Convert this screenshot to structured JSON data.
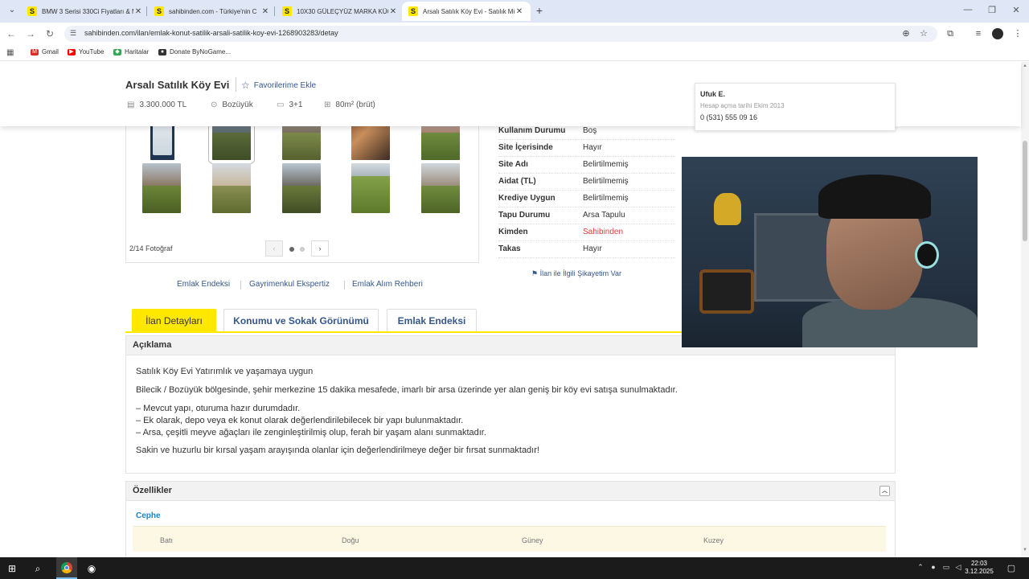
{
  "browser": {
    "tabs": [
      {
        "title": "BMW 3 Serisi 330Ci Fiyatları & M",
        "favicon": "S"
      },
      {
        "title": "sahibinden.com - Türkiye'nin C",
        "favicon": "S"
      },
      {
        "title": "10X30 GÜLEÇYÜZ MARKA KÜÇ",
        "favicon": "S"
      },
      {
        "title": "Arsalı Satılık Köy Evi - Satılık Mü",
        "favicon": "S"
      }
    ],
    "url": "sahibinden.com/ilan/emlak-konut-satilik-arsali-satilik-koy-evi-1268903283/detay",
    "bookmarks": [
      {
        "label": "Gmail",
        "color": "#d93025",
        "icon": "M"
      },
      {
        "label": "YouTube",
        "color": "#ff0000",
        "icon": "▶"
      },
      {
        "label": "Haritalar",
        "color": "#34a853",
        "icon": "◆"
      },
      {
        "label": "Donate ByNoGame...",
        "color": "#333333",
        "icon": "●"
      }
    ]
  },
  "listing": {
    "title": "Arsalı Satılık Köy Evi",
    "favorite_label": "Favorilerime Ekle",
    "price": "3.300.000 TL",
    "location": "Bozüyük",
    "rooms": "3+1",
    "area": "80m² (brüt)"
  },
  "seller": {
    "name": "Ufuk E.",
    "account_label": "Hesap açma tarihi",
    "account_date": "Ekim 2013",
    "phone": "0 (531) 555 09 16"
  },
  "gallery": {
    "counter": "2/14 Fotoğraf"
  },
  "properties": [
    {
      "label": "Kullanım Durumu",
      "value": "Boş"
    },
    {
      "label": "Site İçerisinde",
      "value": "Hayır"
    },
    {
      "label": "Site Adı",
      "value": "Belirtilmemiş"
    },
    {
      "label": "Aidat (TL)",
      "value": "Belirtilmemiş"
    },
    {
      "label": "Krediye Uygun",
      "value": "Belirtilmemiş"
    },
    {
      "label": "Tapu Durumu",
      "value": "Arsa Tapulu"
    },
    {
      "label": "Kimden",
      "value": "Sahibinden",
      "accent": "#e03b3b"
    },
    {
      "label": "Takas",
      "value": "Hayır"
    }
  ],
  "complaint_link": "İlan ile İlgili Şikayetim Var",
  "sub_links": [
    "Emlak Endeksi",
    "Gayrimenkul Ekspertiz",
    "Emlak Alım Rehberi"
  ],
  "detail_tabs": [
    "İlan Detayları",
    "Konumu ve Sokak Görünümü",
    "Emlak Endeksi"
  ],
  "description": {
    "heading": "Açıklama",
    "lines": [
      "Satılık Köy Evi Yatırımlık ve yaşamaya uygun",
      "Bilecik / Bozüyük bölgesinde, şehir merkezine 15 dakika mesafede, imarlı bir arsa üzerinde yer alan geniş bir köy evi satışa sunulmaktadır.",
      "– Mevcut yapı, oturuma hazır durumdadır.",
      "– Ek olarak, depo veya ek konut olarak değerlendirilebilecek bir yapı bulunmaktadır.",
      "– Arsa, çeşitli meyve ağaçları ile zenginleştirilmiş olup, ferah bir yaşam alanı sunmaktadır.",
      "Sakin ve huzurlu bir kırsal yaşam arayışında olanlar için değerlendirilmeye değer bir fırsat sunmaktadır!"
    ]
  },
  "features": {
    "heading": "Özellikler",
    "section": "Cephe",
    "facades": [
      "Batı",
      "Doğu",
      "Güney",
      "Kuzey"
    ]
  },
  "taskbar": {
    "time": "22:03",
    "date": "3.12.2025"
  },
  "colors": {
    "brand_yellow": "#ffe800",
    "link_blue": "#36578a",
    "accent_red": "#e03b3b"
  }
}
